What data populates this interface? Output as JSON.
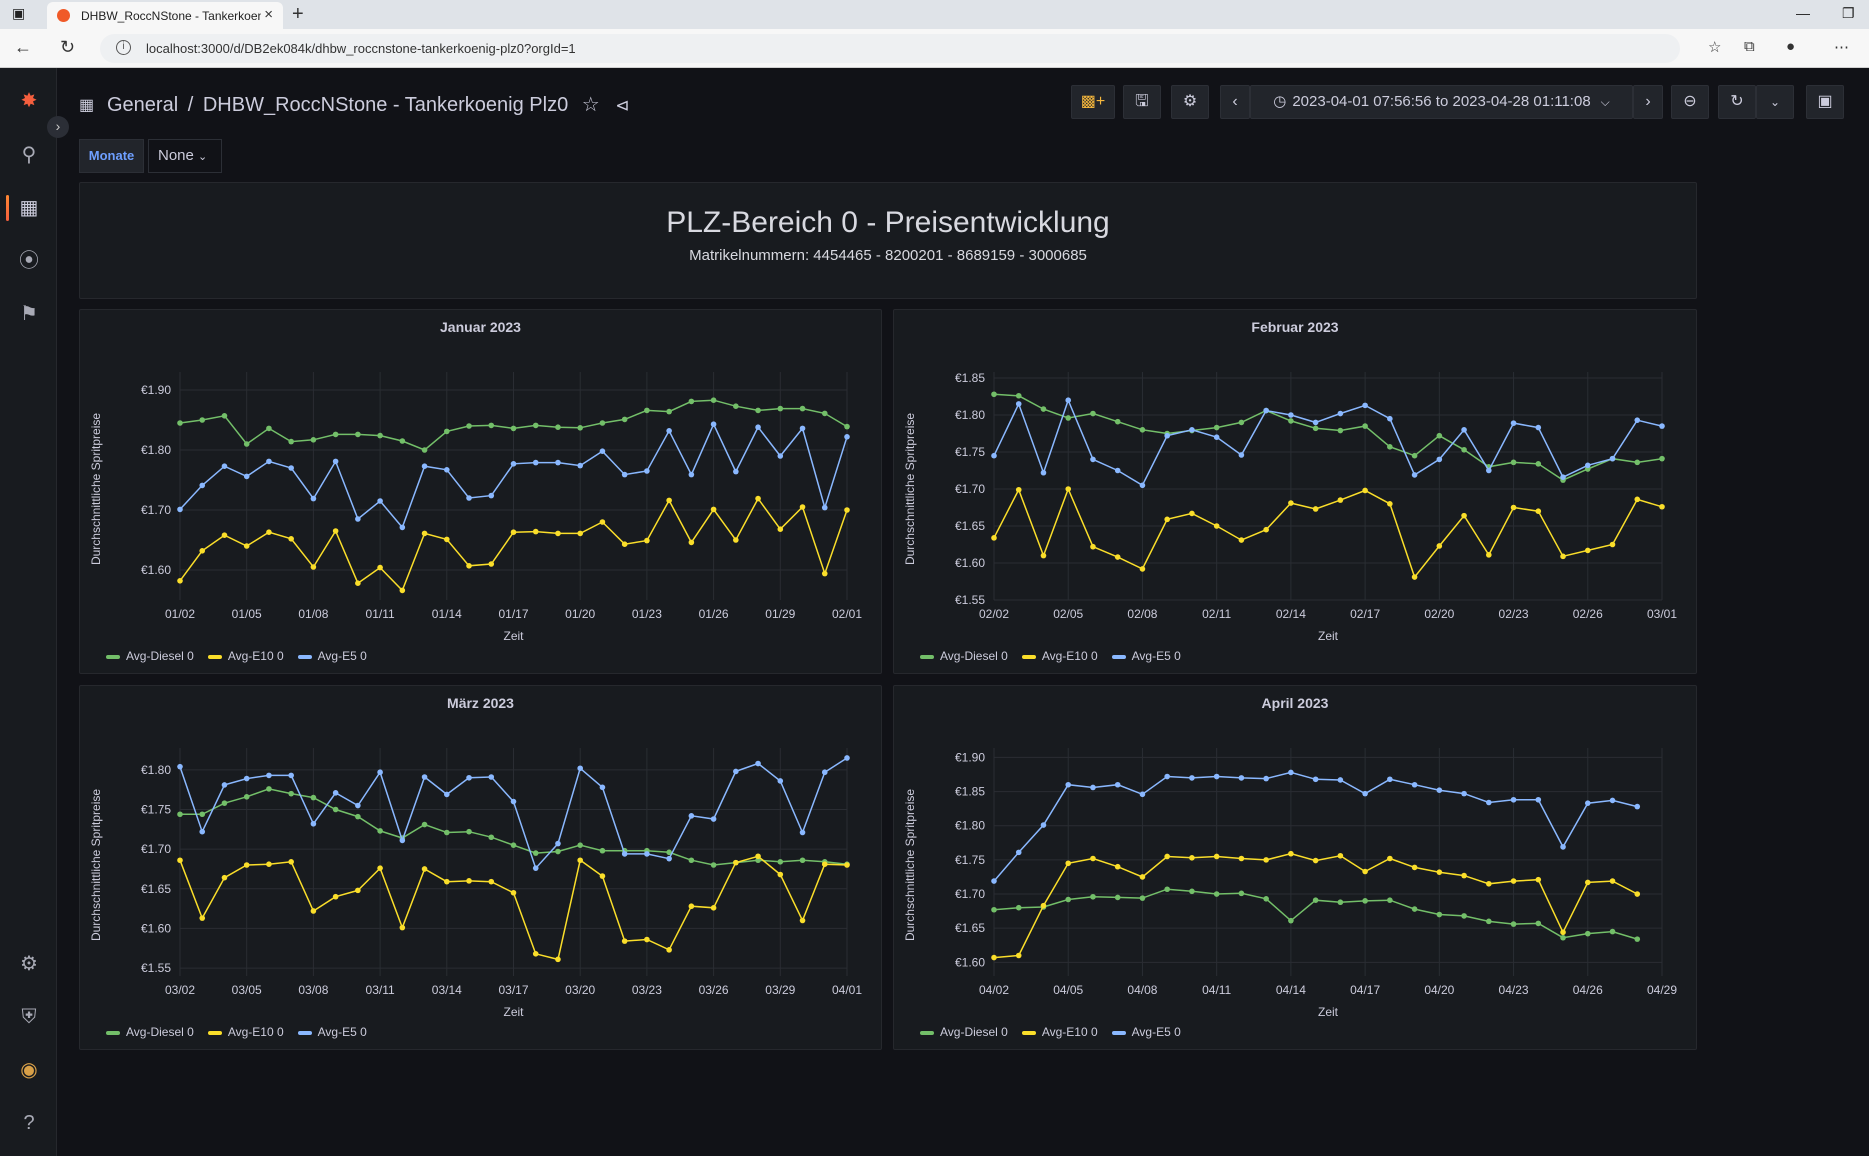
{
  "browser": {
    "tab_title": "DHBW_RoccNStone - Tankerkoen",
    "url": "localhost:3000/d/DB2ek084k/dhbw_roccnstone-tankerkoenig-plz0?orgId=1"
  },
  "breadcrumb": {
    "folder": "General",
    "separator": "/",
    "dashboard": "DHBW_RoccNStone - Tankerkoenig Plz0"
  },
  "time_range": {
    "from": "2023-04-01 07:56:56",
    "to_word": "to",
    "to": "2023-04-28 01:11:08"
  },
  "variable": {
    "label": "Monate",
    "value": "None"
  },
  "header_panel": {
    "title": "PLZ-Bereich 0 - Preisentwicklung",
    "subtitle": "Matrikelnummern: 4454465 - 8200201 - 8689159 - 3000685"
  },
  "colors": {
    "diesel": "#73bf69",
    "e10": "#fade2a",
    "e5": "#8ab8ff",
    "accent": "#f55f3e"
  },
  "chart_data": [
    {
      "type": "line",
      "title": "Januar 2023",
      "xlabel": "Zeit",
      "ylabel": "Durchschnittliche Spritpreise",
      "x_ticks": [
        "01/02",
        "01/05",
        "01/08",
        "01/11",
        "01/14",
        "01/17",
        "01/20",
        "01/23",
        "01/26",
        "01/29",
        "02/01"
      ],
      "y_ticks": [
        "€1.60",
        "€1.70",
        "€1.80",
        "€1.90"
      ],
      "ylim": [
        1.55,
        1.92
      ],
      "x_start_day": 2,
      "legend": [
        "Avg-Diesel 0",
        "Avg-E10 0",
        "Avg-E5 0"
      ],
      "series": [
        {
          "name": "Avg-Diesel 0",
          "color": "#73bf69",
          "values": [
            1.845,
            1.85,
            1.857,
            1.81,
            1.836,
            1.814,
            1.817,
            1.826,
            1.826,
            1.824,
            1.815,
            1.8,
            1.831,
            1.84,
            1.841,
            1.836,
            1.841,
            1.838,
            1.837,
            1.845,
            1.851,
            1.866,
            1.864,
            1.881,
            1.883,
            1.873,
            1.866,
            1.869,
            1.869,
            1.861,
            1.839
          ]
        },
        {
          "name": "Avg-E10 0",
          "color": "#fade2a",
          "values": [
            1.582,
            1.632,
            1.658,
            1.64,
            1.663,
            1.652,
            1.605,
            1.665,
            1.578,
            1.604,
            1.566,
            1.661,
            1.651,
            1.607,
            1.61,
            1.663,
            1.664,
            1.661,
            1.661,
            1.68,
            1.643,
            1.649,
            1.716,
            1.646,
            1.701,
            1.65,
            1.719,
            1.668,
            1.705,
            1.594,
            1.7
          ]
        },
        {
          "name": "Avg-E5 0",
          "color": "#8ab8ff",
          "values": [
            1.701,
            1.741,
            1.773,
            1.756,
            1.781,
            1.77,
            1.719,
            1.781,
            1.685,
            1.715,
            1.671,
            1.773,
            1.767,
            1.72,
            1.724,
            1.777,
            1.779,
            1.779,
            1.774,
            1.798,
            1.759,
            1.765,
            1.832,
            1.759,
            1.843,
            1.764,
            1.838,
            1.79,
            1.836,
            1.704,
            1.822
          ]
        }
      ]
    },
    {
      "type": "line",
      "title": "Februar 2023",
      "xlabel": "Zeit",
      "ylabel": "Durchschnittliche Spritpreise",
      "x_ticks": [
        "02/02",
        "02/05",
        "02/08",
        "02/11",
        "02/14",
        "02/17",
        "02/20",
        "02/23",
        "02/26",
        "03/01"
      ],
      "y_ticks": [
        "€1.55",
        "€1.60",
        "€1.65",
        "€1.70",
        "€1.75",
        "€1.80",
        "€1.85"
      ],
      "ylim": [
        1.55,
        1.85
      ],
      "x_start_day": 2,
      "legend": [
        "Avg-Diesel 0",
        "Avg-E10 0",
        "Avg-E5 0"
      ],
      "series": [
        {
          "name": "Avg-Diesel 0",
          "color": "#73bf69",
          "values": [
            1.828,
            1.826,
            1.808,
            1.796,
            1.802,
            1.791,
            1.78,
            1.775,
            1.779,
            1.783,
            1.79,
            1.806,
            1.792,
            1.782,
            1.779,
            1.785,
            1.757,
            1.745,
            1.772,
            1.753,
            1.73,
            1.736,
            1.734,
            1.712,
            1.727,
            1.741,
            1.736,
            1.741
          ]
        },
        {
          "name": "Avg-E10 0",
          "color": "#fade2a",
          "values": [
            1.634,
            1.699,
            1.61,
            1.7,
            1.622,
            1.608,
            1.592,
            1.659,
            1.667,
            1.65,
            1.631,
            1.645,
            1.681,
            1.673,
            1.685,
            1.698,
            1.68,
            1.581,
            1.623,
            1.664,
            1.611,
            1.675,
            1.67,
            1.609,
            1.617,
            1.625,
            1.686,
            1.676
          ]
        },
        {
          "name": "Avg-E5 0",
          "color": "#8ab8ff",
          "values": [
            1.745,
            1.815,
            1.722,
            1.82,
            1.74,
            1.725,
            1.705,
            1.772,
            1.78,
            1.77,
            1.746,
            1.806,
            1.8,
            1.79,
            1.802,
            1.813,
            1.795,
            1.719,
            1.74,
            1.78,
            1.725,
            1.789,
            1.783,
            1.716,
            1.732,
            1.741,
            1.793,
            1.785
          ]
        }
      ]
    },
    {
      "type": "line",
      "title": "März 2023",
      "xlabel": "Zeit",
      "ylabel": "Durchschnittliche Spritpreise",
      "x_ticks": [
        "03/02",
        "03/05",
        "03/08",
        "03/11",
        "03/14",
        "03/17",
        "03/20",
        "03/23",
        "03/26",
        "03/29",
        "04/01"
      ],
      "y_ticks": [
        "€1.55",
        "€1.60",
        "€1.65",
        "€1.70",
        "€1.75",
        "€1.80"
      ],
      "ylim": [
        1.54,
        1.82
      ],
      "x_start_day": 2,
      "legend": [
        "Avg-Diesel 0",
        "Avg-E10 0",
        "Avg-E5 0"
      ],
      "series": [
        {
          "name": "Avg-Diesel 0",
          "color": "#73bf69",
          "values": [
            1.744,
            1.744,
            1.758,
            1.766,
            1.776,
            1.77,
            1.765,
            1.75,
            1.741,
            1.723,
            1.714,
            1.731,
            1.721,
            1.722,
            1.715,
            1.705,
            1.695,
            1.697,
            1.705,
            1.698,
            1.698,
            1.698,
            1.696,
            1.686,
            1.68,
            1.683,
            1.686,
            1.684,
            1.686,
            1.684,
            1.681
          ]
        },
        {
          "name": "Avg-E10 0",
          "color": "#fade2a",
          "values": [
            1.686,
            1.613,
            1.664,
            1.68,
            1.681,
            1.684,
            1.622,
            1.64,
            1.648,
            1.676,
            1.601,
            1.675,
            1.659,
            1.66,
            1.659,
            1.645,
            1.568,
            1.561,
            1.686,
            1.666,
            1.584,
            1.586,
            1.573,
            1.628,
            1.626,
            1.683,
            1.691,
            1.668,
            1.61,
            1.681,
            1.68
          ]
        },
        {
          "name": "Avg-E5 0",
          "color": "#8ab8ff",
          "values": [
            1.804,
            1.722,
            1.781,
            1.789,
            1.793,
            1.793,
            1.732,
            1.771,
            1.755,
            1.797,
            1.711,
            1.791,
            1.769,
            1.79,
            1.791,
            1.76,
            1.676,
            1.707,
            1.802,
            1.778,
            1.694,
            1.694,
            1.688,
            1.742,
            1.738,
            1.798,
            1.808,
            1.786,
            1.721,
            1.797,
            1.815
          ]
        }
      ]
    },
    {
      "type": "line",
      "title": "April 2023",
      "xlabel": "Zeit",
      "ylabel": "Durchschnittliche Spritpreise",
      "x_ticks": [
        "04/02",
        "04/05",
        "04/08",
        "04/11",
        "04/14",
        "04/17",
        "04/20",
        "04/23",
        "04/26",
        "04/29"
      ],
      "y_ticks": [
        "€1.60",
        "€1.65",
        "€1.70",
        "€1.75",
        "€1.80",
        "€1.85",
        "€1.90"
      ],
      "ylim": [
        1.58,
        1.905
      ],
      "x_start_day": 2,
      "legend": [
        "Avg-Diesel 0",
        "Avg-E10 0",
        "Avg-E5 0"
      ],
      "series": [
        {
          "name": "Avg-Diesel 0",
          "color": "#73bf69",
          "values": [
            1.677,
            1.68,
            1.681,
            1.692,
            1.696,
            1.695,
            1.694,
            1.707,
            1.704,
            1.7,
            1.701,
            1.693,
            1.661,
            1.691,
            1.688,
            1.69,
            1.691,
            1.678,
            1.67,
            1.668,
            1.66,
            1.656,
            1.657,
            1.636,
            1.642,
            1.645,
            1.634
          ]
        },
        {
          "name": "Avg-E10 0",
          "color": "#fade2a",
          "values": [
            1.607,
            1.61,
            1.683,
            1.745,
            1.752,
            1.74,
            1.725,
            1.755,
            1.753,
            1.755,
            1.752,
            1.75,
            1.759,
            1.749,
            1.756,
            1.733,
            1.752,
            1.739,
            1.732,
            1.727,
            1.715,
            1.719,
            1.721,
            1.644,
            1.717,
            1.719,
            1.7
          ]
        },
        {
          "name": "Avg-E5 0",
          "color": "#8ab8ff",
          "values": [
            1.719,
            1.761,
            1.801,
            1.86,
            1.856,
            1.86,
            1.846,
            1.872,
            1.87,
            1.872,
            1.87,
            1.869,
            1.878,
            1.868,
            1.867,
            1.847,
            1.868,
            1.86,
            1.852,
            1.847,
            1.834,
            1.838,
            1.838,
            1.769,
            1.833,
            1.837,
            1.828
          ]
        }
      ]
    }
  ]
}
